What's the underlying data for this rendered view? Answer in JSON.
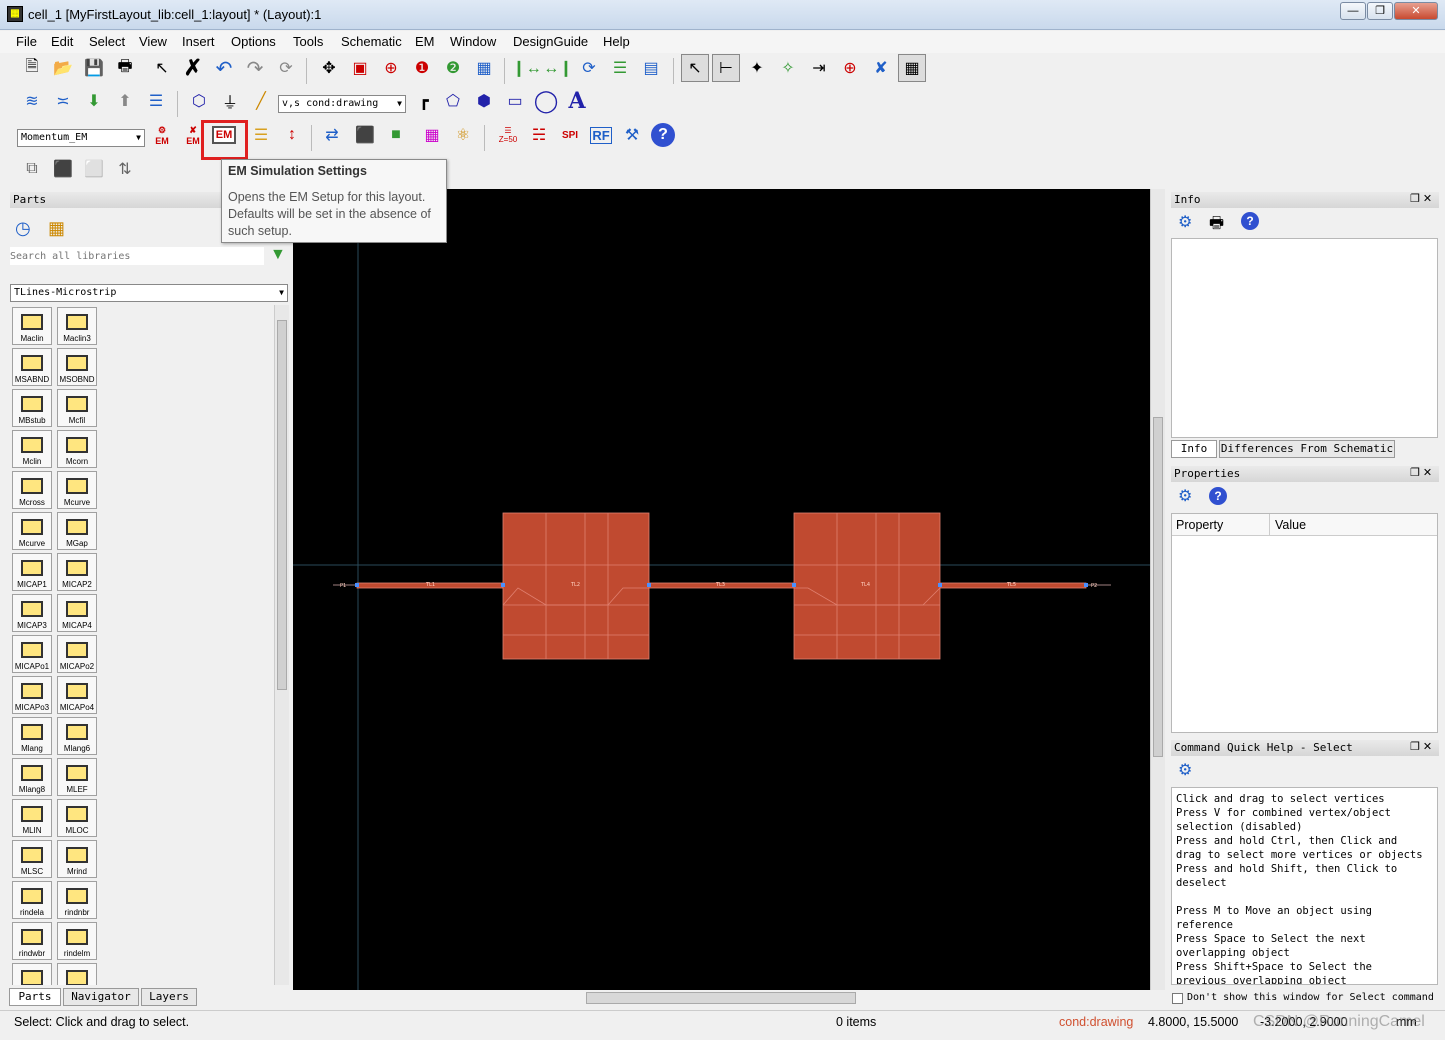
{
  "window": {
    "title": "cell_1 [MyFirstLayout_lib:cell_1:layout] * (Layout):1"
  },
  "menu": [
    "File",
    "Edit",
    "Select",
    "View",
    "Insert",
    "Options",
    "Tools",
    "Schematic",
    "EM",
    "Window",
    "DesignGuide",
    "Help"
  ],
  "toolbar": {
    "cond_value": "v,s cond:drawing",
    "em_engine": "Momentum_EM",
    "em_button": "EM",
    "rf_button": "RF",
    "spi_button": "SPI",
    "z50": "Z=50"
  },
  "tooltip": {
    "title": "EM Simulation Settings",
    "body": "Opens the EM Setup for this layout. Defaults will be set in the absence of such setup."
  },
  "parts": {
    "title": "Parts",
    "search_placeholder": "Search all libraries",
    "library": "TLines-Microstrip",
    "items": [
      "Maclin",
      "Maclin3",
      "MSABND",
      "MSOBND",
      "MBstub",
      "Mcfil",
      "Mclin",
      "Mcorn",
      "Mcross",
      "Mcurve",
      "Mcurve",
      "MGap",
      "MICAP1",
      "MICAP2",
      "MICAP3",
      "MICAP4",
      "MICAPo1",
      "MICAPo2",
      "MICAPo3",
      "MICAPo4",
      "Mlang",
      "Mlang6",
      "Mlang8",
      "MLEF",
      "MLIN",
      "MLOC",
      "MLSC",
      "Mrind",
      "rindela",
      "rindnbr",
      "rindwbr",
      "rindelm",
      "",
      ""
    ],
    "tabs": [
      "Parts",
      "Navigator",
      "Layers"
    ]
  },
  "layout": {
    "labels": [
      "P1",
      "TL1",
      "TL2",
      "TL3",
      "TL4",
      "TL5",
      "P2"
    ]
  },
  "info": {
    "title": "Info",
    "tabs": [
      "Info",
      "Differences From Schematic"
    ]
  },
  "properties": {
    "title": "Properties",
    "col_property": "Property",
    "col_value": "Value"
  },
  "quickhelp": {
    "title": "Command Quick Help - Select",
    "text": "Click and drag to select vertices\nPress V for combined vertex/object\nselection (disabled)\nPress and hold Ctrl, then Click and\ndrag to select more vertices or objects\nPress and hold Shift, then Click to\ndeselect\n\nPress M to Move an object using\nreference\nPress Space to Select the next\noverlapping object\nPress Shift+Space to Select the\nprevious overlapping object",
    "checkbox": "Don't show this window for Select command"
  },
  "status": {
    "hint": "Select: Click and drag to select.",
    "items": "0 items",
    "cond": "cond:drawing",
    "coords": "4.8000, 15.5000",
    "coords2": "-3.2000, 2.9000",
    "unit": "mm",
    "watermark": "CSDN @RunningCamel"
  }
}
